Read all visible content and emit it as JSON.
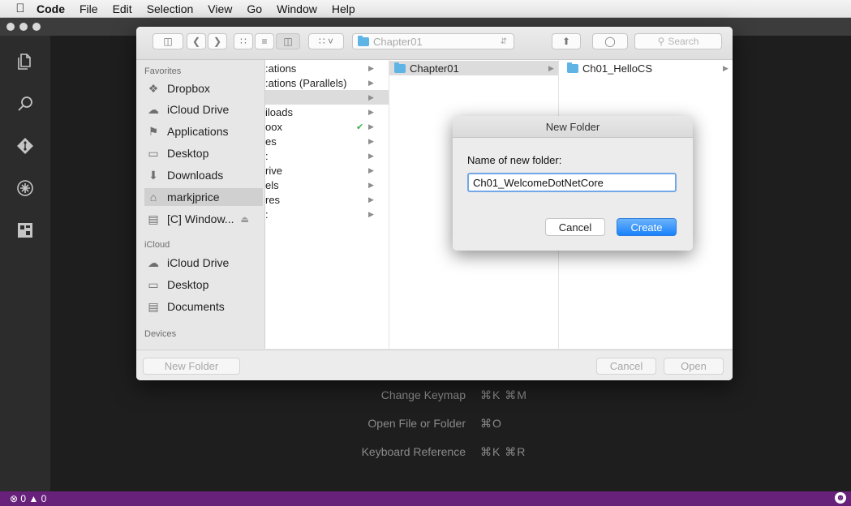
{
  "menubar": {
    "app": "Code",
    "items": [
      "File",
      "Edit",
      "Selection",
      "View",
      "Go",
      "Window",
      "Help"
    ]
  },
  "activity_icons": [
    "explorer-icon",
    "search-icon",
    "git-icon",
    "debug-icon",
    "extensions-icon"
  ],
  "editor": {
    "shortcuts": [
      {
        "label": "Change Keymap",
        "key": "⌘K ⌘M"
      },
      {
        "label": "Open File or Folder",
        "key": "⌘O"
      },
      {
        "label": "Keyboard Reference",
        "key": "⌘K ⌘R"
      }
    ]
  },
  "statusbar": {
    "errors": "0",
    "warnings": "0"
  },
  "open_dialog": {
    "path": "Chapter01",
    "search_placeholder": "Search",
    "sidebar": {
      "favorites_header": "Favorites",
      "favorites": [
        {
          "label": "Dropbox",
          "icon": "dropbox-icon"
        },
        {
          "label": "iCloud Drive",
          "icon": "cloud-icon"
        },
        {
          "label": "Applications",
          "icon": "applications-icon"
        },
        {
          "label": "Desktop",
          "icon": "desktop-icon"
        },
        {
          "label": "Downloads",
          "icon": "downloads-icon"
        },
        {
          "label": "markjprice",
          "icon": "home-icon"
        },
        {
          "label": "[C] Window...",
          "icon": "disk-icon"
        }
      ],
      "icloud_header": "iCloud",
      "icloud": [
        {
          "label": "iCloud Drive",
          "icon": "cloud-icon"
        },
        {
          "label": "Desktop",
          "icon": "desktop-icon"
        },
        {
          "label": "Documents",
          "icon": "documents-icon"
        }
      ],
      "devices_header": "Devices"
    },
    "column1": [
      ":ations",
      ":ations (Parallels)",
      "",
      "iloads",
      "oox",
      "es",
      ":",
      "rive",
      "els",
      "res",
      ":"
    ],
    "column2": [
      "Chapter01"
    ],
    "column3": [
      "Ch01_HelloCS"
    ],
    "buttons": {
      "new_folder": "New Folder",
      "cancel": "Cancel",
      "open": "Open"
    }
  },
  "new_folder_sheet": {
    "title": "New Folder",
    "label": "Name of new folder:",
    "value": "Ch01_WelcomeDotNetCore",
    "cancel": "Cancel",
    "create": "Create"
  }
}
